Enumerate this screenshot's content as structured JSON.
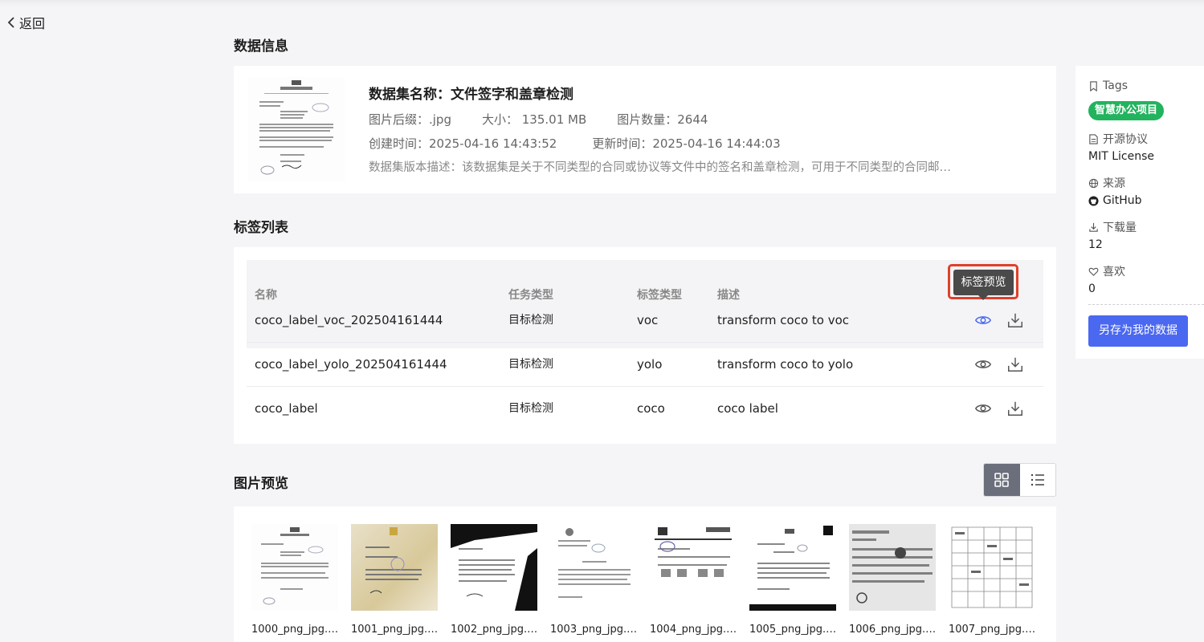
{
  "nav": {
    "back_label": "返回"
  },
  "sections": {
    "data_info": "数据信息",
    "label_list": "标签列表",
    "image_preview": "图片预览"
  },
  "info": {
    "name_label": "数据集名称：文件签字和盖章检测",
    "suffix": "图片后缀：.jpg",
    "size": "大小： 135.01 MB",
    "count": "图片数量：2644",
    "created": "创建时间：2025-04-16 14:43:52",
    "updated": "更新时间：2025-04-16 14:44:03",
    "description": "数据集版本描述：该数据集是关于不同类型的合同或协议等文件中的签名和盖章检测，可用于不同类型的合同邮…"
  },
  "table": {
    "headers": {
      "name": "名称",
      "task": "任务类型",
      "label_type": "标签类型",
      "desc": "描述"
    },
    "rows": [
      {
        "name": "coco_label_voc_202504161444",
        "task": "目标检测",
        "label_type": "voc",
        "desc": "transform coco to voc"
      },
      {
        "name": "coco_label_yolo_202504161444",
        "task": "目标检测",
        "label_type": "yolo",
        "desc": "transform coco to yolo"
      },
      {
        "name": "coco_label",
        "task": "目标检测",
        "label_type": "coco",
        "desc": "coco label"
      }
    ],
    "tooltip": "标签预览"
  },
  "side": {
    "tags_label": "Tags",
    "tag": "智慧办公项目",
    "license_label": "开源协议",
    "license": "MIT License",
    "source_label": "来源",
    "source": "GitHub",
    "downloads_label": "下载量",
    "downloads": "12",
    "likes_label": "喜欢",
    "likes": "0",
    "save_button": "另存为我的数据"
  },
  "preview": {
    "items": [
      {
        "name": "1000_png_jpg.rf.…"
      },
      {
        "name": "1001_png_jpg.rf.…"
      },
      {
        "name": "1002_png_jpg.rf.…"
      },
      {
        "name": "1003_png_jpg.rf.…"
      },
      {
        "name": "1004_png_jpg.rf.…"
      },
      {
        "name": "1005_png_jpg.rf.f…"
      },
      {
        "name": "1006_png_jpg.rf.…"
      },
      {
        "name": "1007_png_jpg.rf.…"
      }
    ]
  },
  "colors": {
    "accent": "#4a68f0",
    "tag_green": "#22b35e",
    "highlight_red": "#e0402a"
  }
}
